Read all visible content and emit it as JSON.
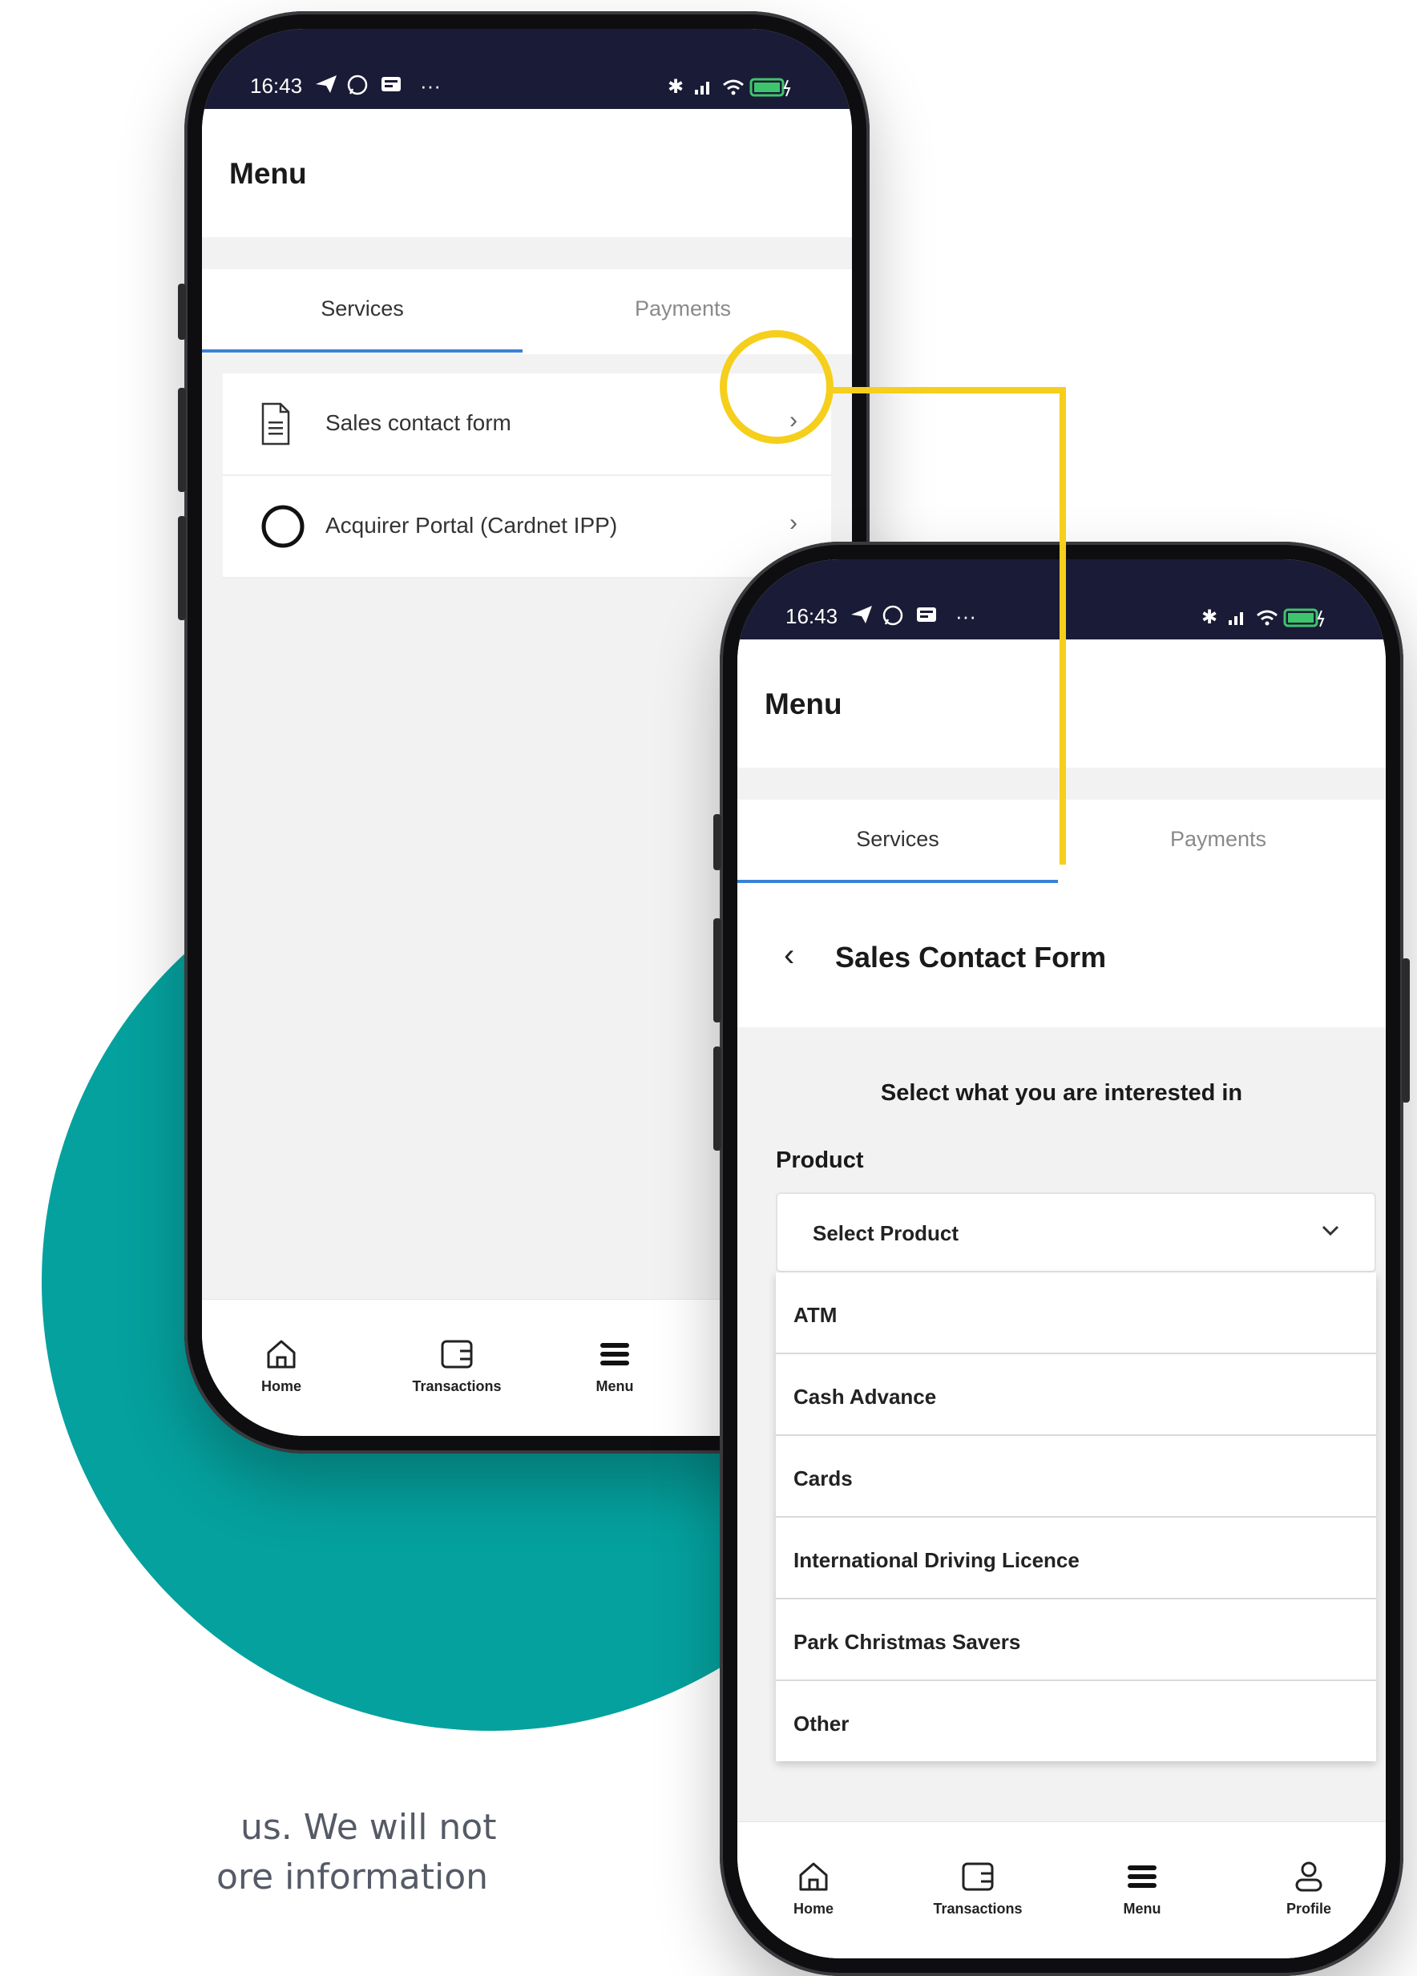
{
  "background_text": {
    "line1": "us. We will not",
    "line2": "ore information"
  },
  "colors": {
    "teal": "#05a19e",
    "status_bar": "#1a1b36",
    "tab_accent": "#3b82d6",
    "callout": "#f5cf1b"
  },
  "status_bar": {
    "time": "16:43",
    "icons_left": [
      "send-icon",
      "whatsapp-icon",
      "notification-icon"
    ],
    "more": "···",
    "battery": "90"
  },
  "phone1": {
    "header_title": "Menu",
    "tabs": [
      {
        "label": "Services",
        "active": true
      },
      {
        "label": "Payments",
        "active": false
      }
    ],
    "menu_items": [
      {
        "label": "Sales contact form",
        "icon": "document-icon"
      },
      {
        "label": "Acquirer Portal (Cardnet IPP)",
        "icon": "circle-icon"
      }
    ],
    "nav": [
      {
        "label": "Home",
        "icon": "home-icon"
      },
      {
        "label": "Transactions",
        "icon": "wallet-icon"
      },
      {
        "label": "Menu",
        "icon": "hamburger-icon"
      }
    ]
  },
  "phone2": {
    "header_title": "Menu",
    "tabs": [
      {
        "label": "Services",
        "active": true
      },
      {
        "label": "Payments",
        "active": false
      }
    ],
    "form": {
      "title": "Sales Contact Form",
      "prompt": "Select what you are interested in",
      "product_label": "Product",
      "select_value": "Select Product",
      "options": [
        "ATM",
        "Cash Advance",
        "Cards",
        "International Driving Licence",
        "Park Christmas Savers",
        "Other"
      ]
    },
    "nav": [
      {
        "label": "Home",
        "icon": "home-icon"
      },
      {
        "label": "Transactions",
        "icon": "wallet-icon"
      },
      {
        "label": "Menu",
        "icon": "hamburger-icon"
      },
      {
        "label": "Profile",
        "icon": "profile-icon"
      }
    ]
  }
}
